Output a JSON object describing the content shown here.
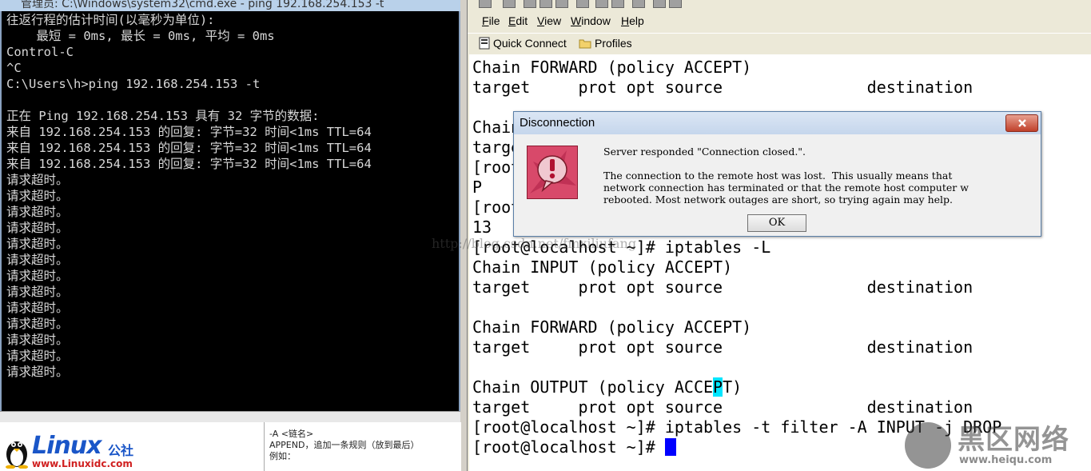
{
  "cmd": {
    "title": "管理员: C:\\Windows\\system32\\cmd.exe - ping  192.168.254.153 -t",
    "lines": [
      "往返行程的估计时间(以毫秒为单位):",
      "    最短 = 0ms, 最长 = 0ms, 平均 = 0ms",
      "Control-C",
      "^C",
      "C:\\Users\\h>ping 192.168.254.153 -t",
      "",
      "正在 Ping 192.168.254.153 具有 32 字节的数据:",
      "来自 192.168.254.153 的回复: 字节=32 时间<1ms TTL=64",
      "来自 192.168.254.153 的回复: 字节=32 时间<1ms TTL=64",
      "来自 192.168.254.153 的回复: 字节=32 时间<1ms TTL=64",
      "请求超时。",
      "请求超时。",
      "请求超时。",
      "请求超时。",
      "请求超时。",
      "请求超时。",
      "请求超时。",
      "请求超时。",
      "请求超时。",
      "请求超时。",
      "请求超时。",
      "请求超时。",
      "请求超时。"
    ]
  },
  "left_bottom": {
    "logo_text": "Linux",
    "logo_cn": "公社",
    "logo_url": "www.Linuxidc.com",
    "doc_lines": [
      "-A <链名>",
      "  APPEND，追加一条规则（放到最后）",
      "",
      "例如："
    ]
  },
  "ssh": {
    "menu": [
      {
        "u": "F",
        "rest": "ile"
      },
      {
        "u": "E",
        "rest": "dit"
      },
      {
        "u": "V",
        "rest": "iew"
      },
      {
        "u": "W",
        "rest": "indow"
      },
      {
        "u": "H",
        "rest": "elp"
      }
    ],
    "quick_connect": "Quick Connect",
    "profiles": "Profiles",
    "terminal_lines": [
      "Chain FORWARD (policy ACCEPT)",
      "target     prot opt source               destination",
      "",
      "Chain OUTPUT (policy ACCEPT)",
      "target     prot opt source               destination",
      "[root@localhost ~]# iptables -A INPUT -j DROP",
      "P",
      "[root@localhost ~]# date     Wed Mar 20 16:46",
      "13",
      "[root@localhost ~]# iptables -L",
      "Chain INPUT (policy ACCEPT)",
      "target     prot opt source               destination",
      "",
      "Chain FORWARD (policy ACCEPT)",
      "target     prot opt source               destination",
      "",
      "Chain OUTPUT (policy ACCE",
      "target     prot opt source               destination",
      "[root@localhost ~]# iptables -t filter -A INPUT -j DROP",
      "[root@localhost ~]# "
    ],
    "output_line_hl": "P",
    "output_line_tail": "T)"
  },
  "dialog": {
    "title": "Disconnection",
    "line1": "Server responded \"Connection closed.\".",
    "line2": "The connection to the remote host was lost.  This usually means that",
    "line3": "network connection has terminated or that the remote host computer w",
    "line4": "rebooted. Most network outages are short, so trying again may help.",
    "ok": "OK"
  },
  "watermark": {
    "url": "http://blog.csdn.net/fmxiliufang",
    "cn": "黑区网络",
    "site": "www.heiqu.com"
  }
}
